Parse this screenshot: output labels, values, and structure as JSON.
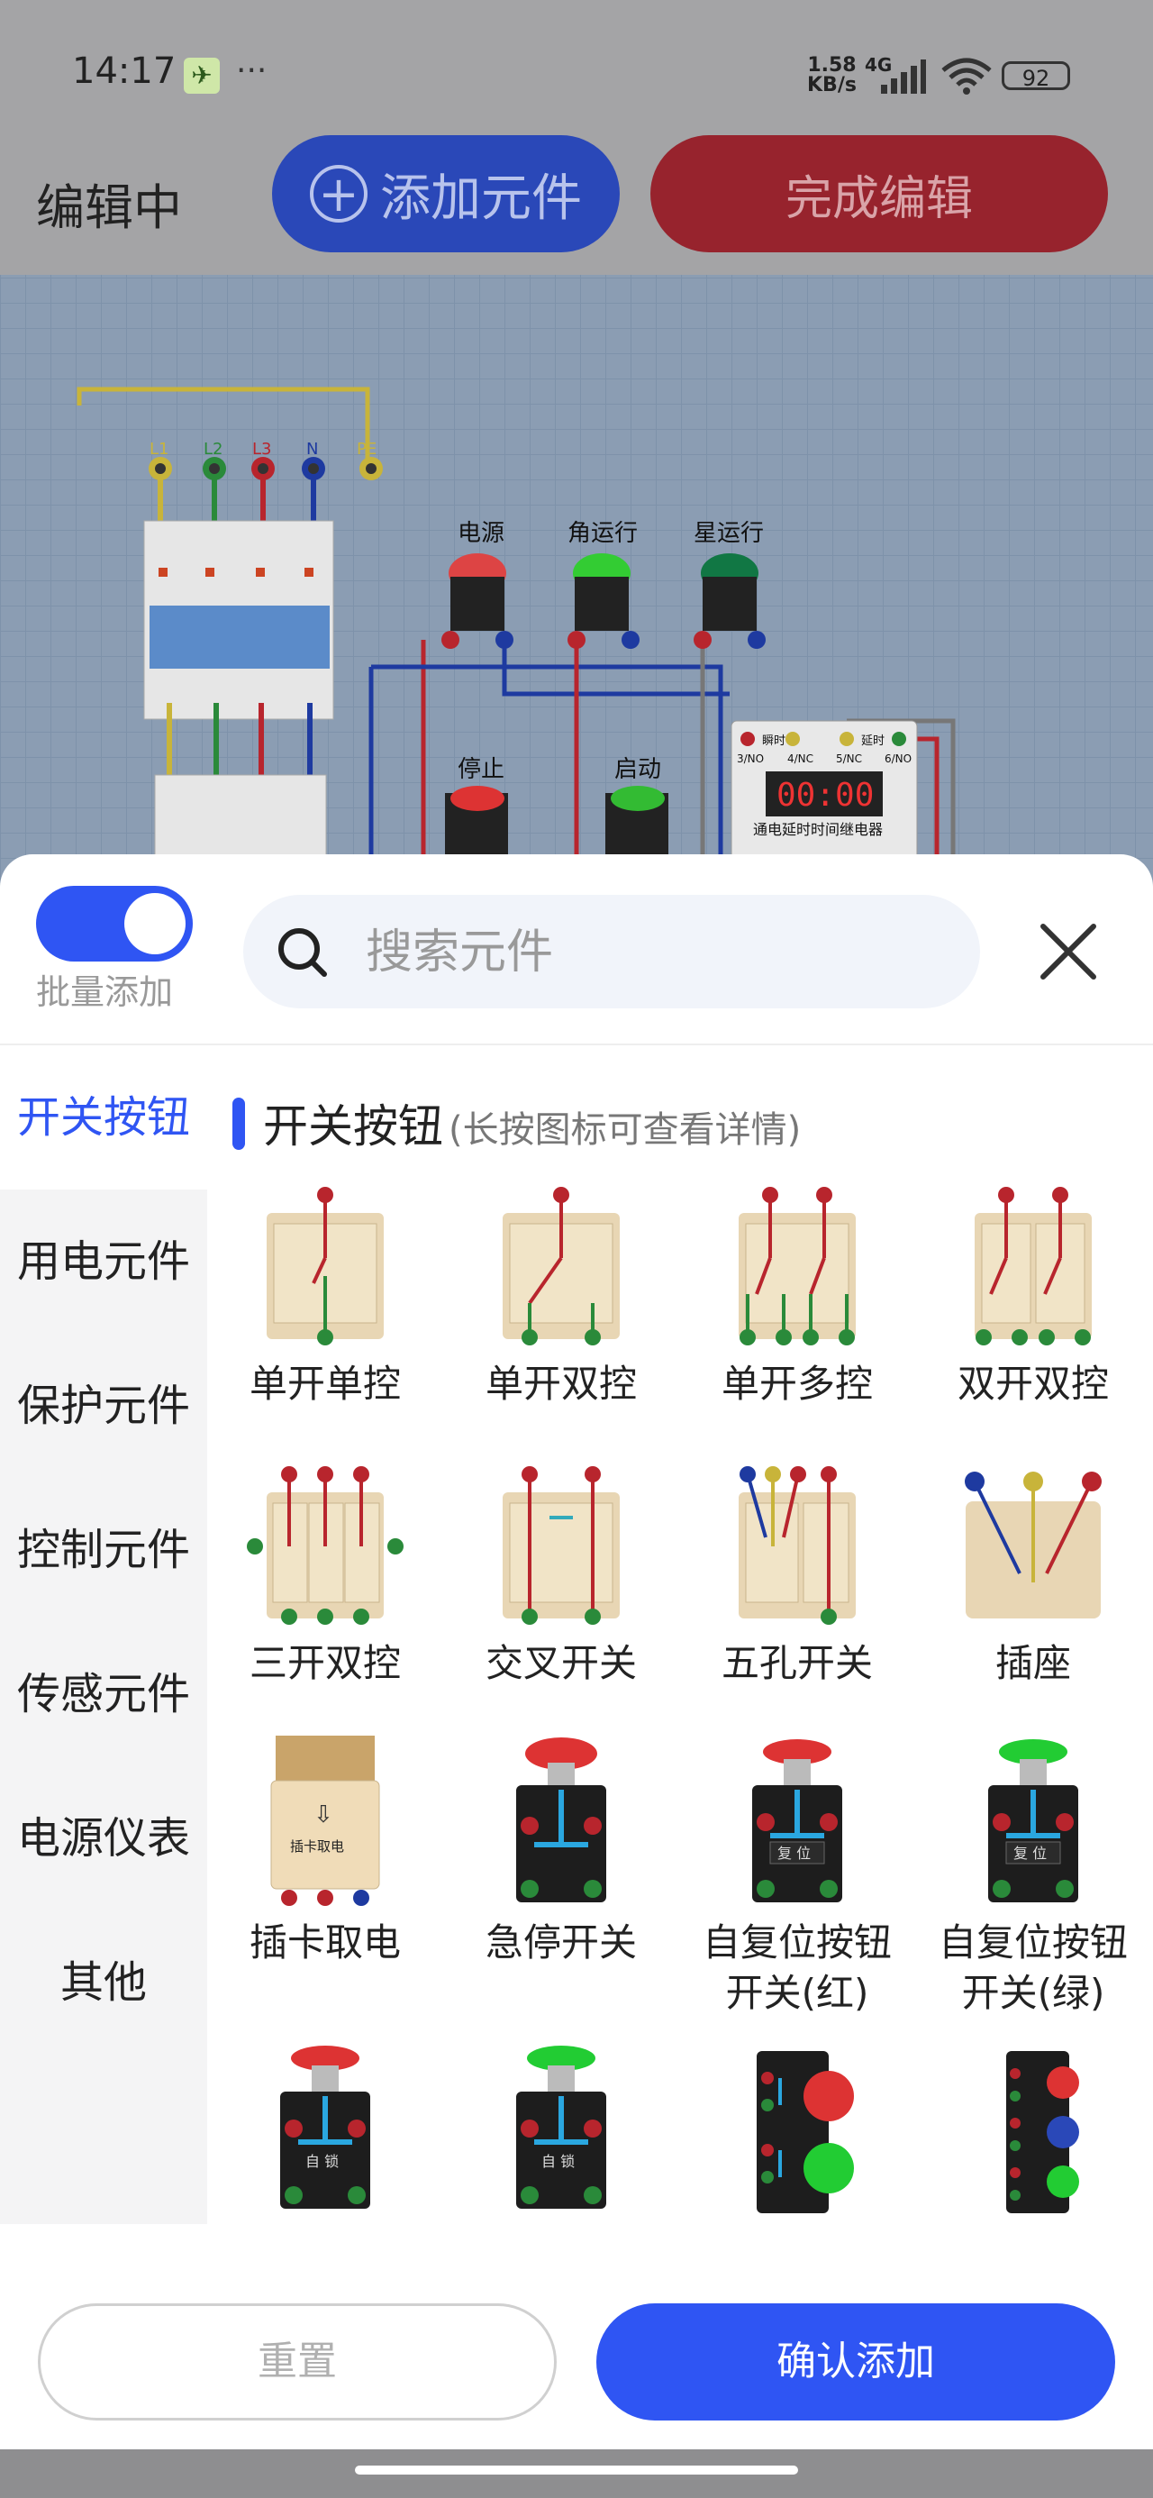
{
  "status_bar": {
    "time": "14:17",
    "dots": "···",
    "speed_value": "1.58",
    "speed_unit": "KB/s",
    "network": "4G",
    "battery": "92"
  },
  "header": {
    "title": "编辑中",
    "add_button": "添加元件",
    "finish_button": "完成编辑"
  },
  "canvas": {
    "terminals": [
      "L1",
      "L2",
      "L3",
      "N",
      "PE"
    ],
    "lamps": [
      "电源",
      "角运行",
      "星运行"
    ],
    "buttons": [
      "停止",
      "启动"
    ],
    "timer": {
      "display": "00:00",
      "caption": "通电延时时间继电器",
      "pins": [
        "瞬时",
        "4/NC",
        "延时",
        "6/NO",
        "3/NO",
        "5/NC"
      ]
    }
  },
  "sheet": {
    "batch_add_label": "批量添加",
    "batch_add_on": true,
    "search_placeholder": "搜索元件",
    "categories": [
      "开关按钮",
      "用电元件",
      "保护元件",
      "控制元件",
      "传感元件",
      "电源仪表",
      "其他"
    ],
    "active_category": "开关按钮",
    "section_title": "开关按钮",
    "section_hint": "(长按图标可查看详情)",
    "items": [
      {
        "label": "单开单控",
        "icon": "single-switch-single-control-icon"
      },
      {
        "label": "单开双控",
        "icon": "single-switch-double-control-icon"
      },
      {
        "label": "单开多控",
        "icon": "single-switch-multi-control-icon"
      },
      {
        "label": "双开双控",
        "icon": "double-switch-double-control-icon"
      },
      {
        "label": "三开双控",
        "icon": "triple-switch-double-control-icon"
      },
      {
        "label": "交叉开关",
        "icon": "cross-switch-icon"
      },
      {
        "label": "五孔开关",
        "icon": "five-hole-switch-icon"
      },
      {
        "label": "插座",
        "icon": "socket-icon"
      },
      {
        "label": "插卡取电",
        "icon": "card-power-switch-icon"
      },
      {
        "label": "急停开关",
        "icon": "emergency-stop-icon"
      },
      {
        "label": "自复位按钮开关(红)",
        "icon": "reset-button-red-icon"
      },
      {
        "label": "自复位按钮开关(绿)",
        "icon": "reset-button-green-icon"
      },
      {
        "label": "",
        "icon": "lock-button-red-icon"
      },
      {
        "label": "",
        "icon": "lock-button-green-icon"
      },
      {
        "label": "",
        "icon": "double-button-box-icon"
      },
      {
        "label": "",
        "icon": "triple-button-box-icon"
      }
    ],
    "button_texts": {
      "card": "插卡取电",
      "reset": "复 位",
      "lock": "自 锁"
    }
  },
  "footer": {
    "reset_label": "重置",
    "confirm_label": "确认添加"
  },
  "colors": {
    "accent": "#2f55f3",
    "finish_red": "#97232d",
    "add_blue": "#2a48b8"
  }
}
